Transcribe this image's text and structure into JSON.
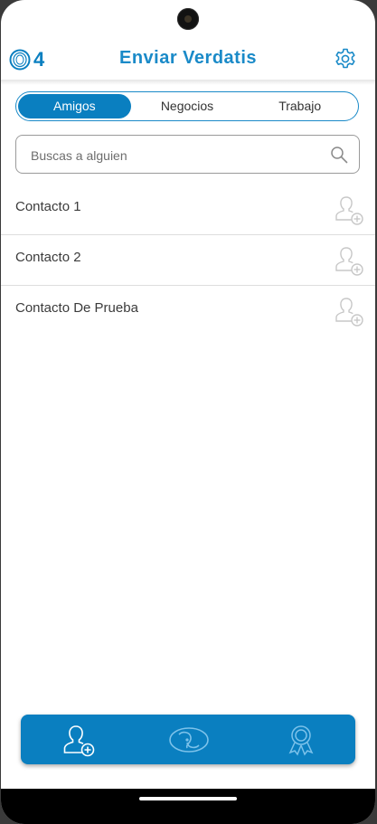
{
  "header": {
    "logo_number": "4",
    "title": "Enviar Verdatis",
    "settings_icon": "gear-icon"
  },
  "tabs": [
    {
      "label": "Amigos",
      "active": true
    },
    {
      "label": "Negocios",
      "active": false
    },
    {
      "label": "Trabajo",
      "active": false
    }
  ],
  "search": {
    "placeholder": "Buscas a alguien",
    "value": "",
    "icon": "search-icon"
  },
  "contacts": [
    {
      "name": "Contacto 1",
      "icon": "add-contact-icon"
    },
    {
      "name": "Contacto 2",
      "icon": "add-contact-icon"
    },
    {
      "name": "Contacto De Prueba",
      "icon": "add-contact-icon"
    }
  ],
  "bottom_nav": [
    {
      "icon": "add-user-icon"
    },
    {
      "icon": "verdatis-logo-icon"
    },
    {
      "icon": "award-ribbon-icon"
    }
  ],
  "colors": {
    "accent": "#0a7fc0",
    "title": "#1a8ac8",
    "icon_gray": "#c7c7c7"
  }
}
